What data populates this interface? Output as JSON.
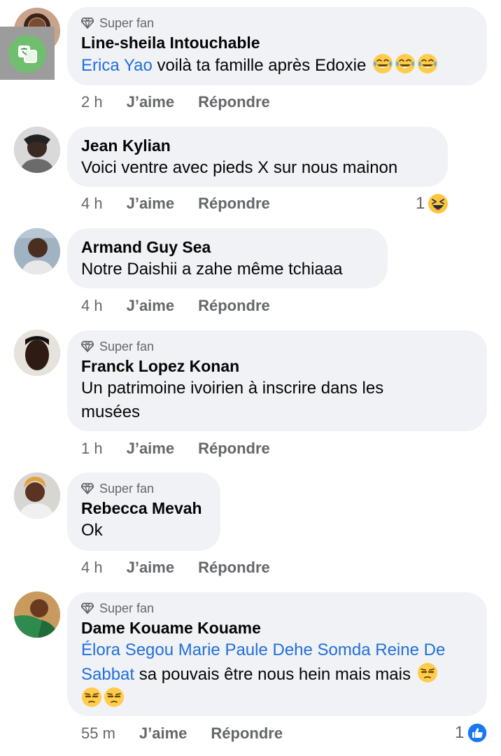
{
  "comments": [
    {
      "badge": "Super fan",
      "name": "Line-sheila Intouchable",
      "mention": "Erica Yao",
      "text": " voilà ta famille après Edoxie ",
      "emojis": [
        "face-with-tears-of-joy",
        "face-with-tears-of-joy",
        "face-with-tears-of-joy"
      ],
      "time": "2 h",
      "like": "J’aime",
      "reply": "Répondre"
    },
    {
      "name": "Jean Kylian",
      "text": "Voici ventre avec pieds X sur nous mainon",
      "time": "4 h",
      "like": "J’aime",
      "reply": "Répondre",
      "reaction_count": "1",
      "reaction_icon": "haha-reaction-icon"
    },
    {
      "name": "Armand Guy Sea",
      "text": "Notre Daishii a zahe même tchiaaa",
      "time": "4 h",
      "like": "J’aime",
      "reply": "Répondre"
    },
    {
      "badge": "Super fan",
      "name": "Franck Lopez Konan",
      "text_line1": "Un patrimoine ivoirien à inscrire dans les",
      "text_line2": "musées",
      "time": "1 h",
      "like": "J’aime",
      "reply": "Répondre"
    },
    {
      "badge": "Super fan",
      "name": "Rebecca Mevah",
      "text": "Ok",
      "time": "4 h",
      "like": "J’aime",
      "reply": "Répondre"
    },
    {
      "badge": "Super fan",
      "name": "Dame Kouame Kouame",
      "mention_line1": "Élora Segou Marie Paule Dehe Somda Reine De",
      "mention_line2": "Sabbat",
      "text": " sa pouvais être nous hein mais mais ",
      "emojis": [
        "unamused-face",
        "unamused-face",
        "unamused-face"
      ],
      "time": "55 m",
      "like": "J’aime",
      "reply": "Répondre",
      "reaction_count": "1",
      "reaction_icon": "like-reaction-icon"
    }
  ],
  "colors": {
    "bubble": "#f0f2f5",
    "mention": "#216fdb",
    "meta": "#65676b",
    "like_blue": "#1877f2",
    "emoji_yellow": "#ffcc4d"
  }
}
